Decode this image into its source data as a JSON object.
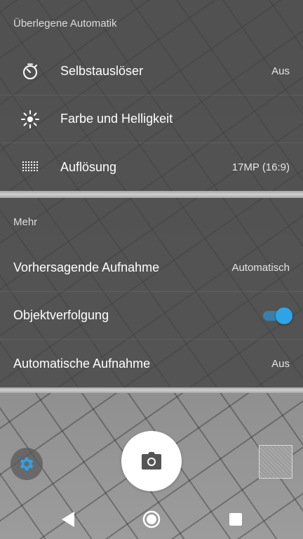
{
  "sections": [
    {
      "title": "Überlegene Automatik",
      "items": [
        {
          "icon": "self-timer-icon",
          "label": "Selbstauslöser",
          "value": "Aus"
        },
        {
          "icon": "brightness-icon",
          "label": "Farbe und Helligkeit",
          "value": ""
        },
        {
          "icon": "resolution-grid-icon",
          "label": "Auflösung",
          "value": "17MP (16:9)"
        }
      ]
    },
    {
      "title": "Mehr",
      "items": [
        {
          "label": "Vorhersagende Aufnahme",
          "value": "Automatisch"
        },
        {
          "label": "Objektverfolgung",
          "toggle": true
        },
        {
          "label": "Automatische Aufnahme",
          "value": "Aus"
        }
      ]
    }
  ],
  "colors": {
    "accent": "#2ea3e8",
    "panel": "#444444",
    "text": "#ffffff"
  },
  "icons": {
    "settings": "gear-icon",
    "shutter": "camera-icon",
    "back": "back-triangle-icon",
    "home": "home-circle-icon",
    "recent": "recent-apps-square-icon"
  }
}
